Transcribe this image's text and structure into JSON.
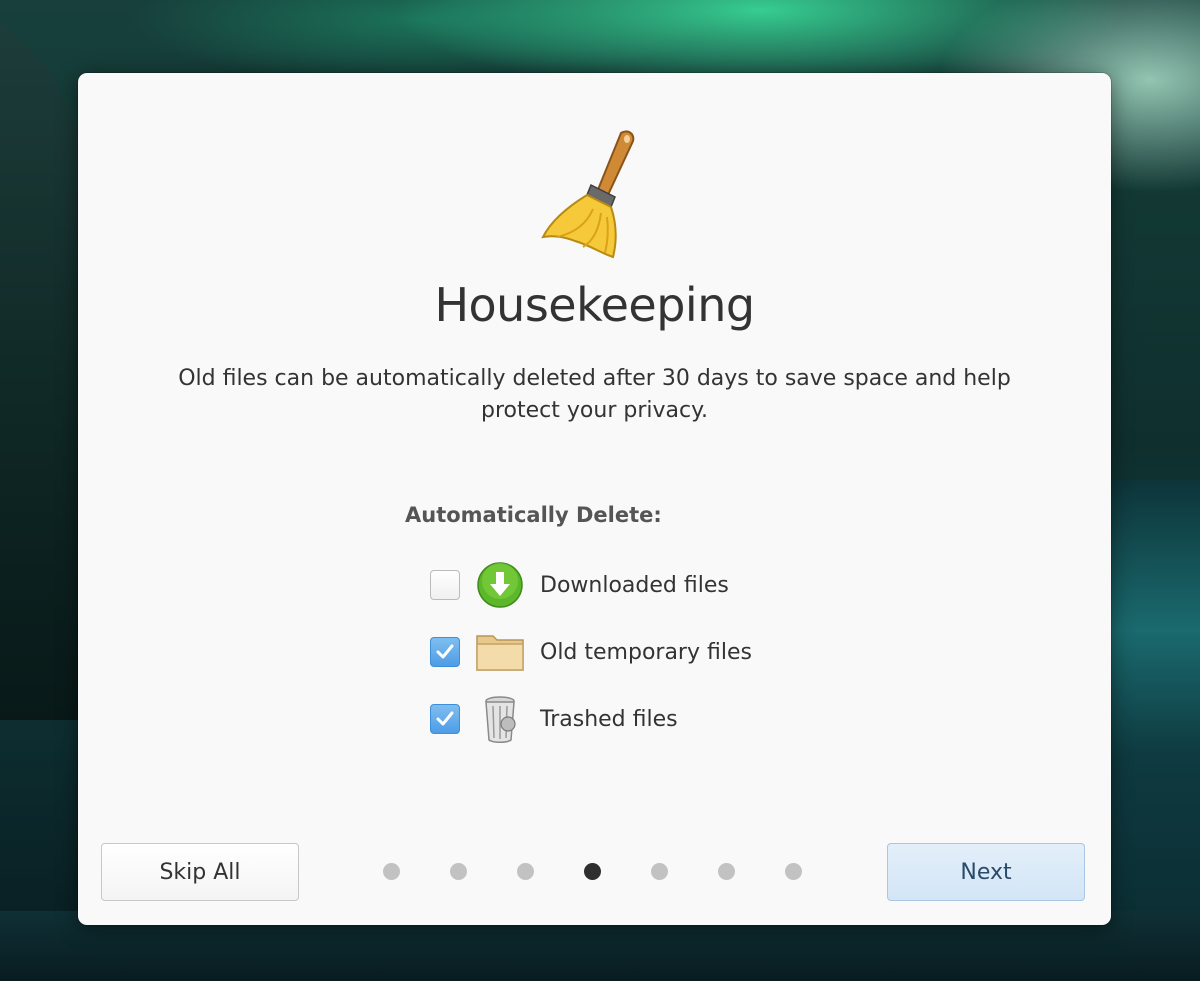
{
  "dialog": {
    "title": "Housekeeping",
    "description": "Old files can be automatically deleted after 30 days to save space and help protect your privacy.",
    "section_label": "Automatically Delete:",
    "options": [
      {
        "label": "Downloaded files",
        "checked": false,
        "icon": "download-arrow-icon"
      },
      {
        "label": "Old temporary files",
        "checked": true,
        "icon": "folder-icon"
      },
      {
        "label": "Trashed files",
        "checked": true,
        "icon": "trash-can-icon"
      }
    ],
    "skip_label": "Skip All",
    "next_label": "Next",
    "pagination": {
      "total": 7,
      "current": 4
    }
  },
  "icons": {
    "header": "broom-icon"
  },
  "colors": {
    "checkbox_checked": "#4d9de6",
    "download_green": "#5cb82a",
    "next_button": "#d3e5f6",
    "dot_active": "#2f2f2f",
    "dot_inactive": "#c2c2c2"
  }
}
